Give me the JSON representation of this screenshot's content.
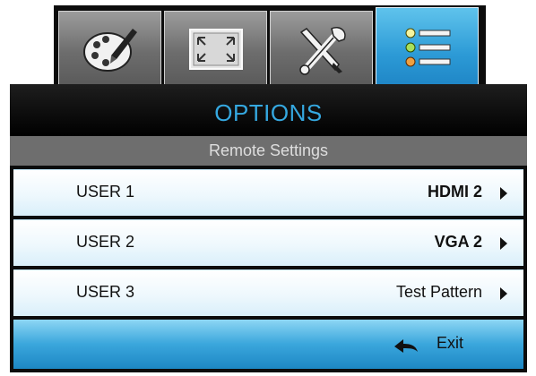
{
  "tabs": [
    {
      "icon": "palette-icon",
      "selected": false
    },
    {
      "icon": "display-fullscreen-icon",
      "selected": false
    },
    {
      "icon": "wrench-screwdriver-icon",
      "selected": false
    },
    {
      "icon": "options-list-icon",
      "selected": true
    }
  ],
  "menu": {
    "title": "OPTIONS",
    "subtitle": "Remote Settings",
    "items": [
      {
        "label": "USER 1",
        "value": "HDMI 2"
      },
      {
        "label": "USER 2",
        "value": "VGA 2"
      },
      {
        "label": "USER 3",
        "value": "Test Pattern"
      }
    ],
    "exit_label": "Exit"
  },
  "colors": {
    "title": "#35a8e0",
    "active_tab": "#2c9ad6",
    "exit_bar": "#3aa6dc"
  }
}
